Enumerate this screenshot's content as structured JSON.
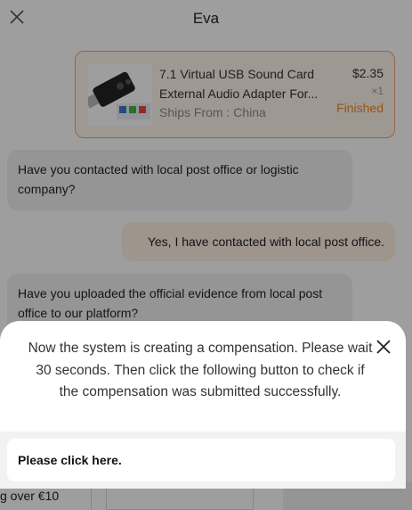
{
  "header": {
    "title": "Eva",
    "close_icon": "close-icon"
  },
  "order": {
    "name_line1": "7.1 Virtual USB Sound Card",
    "name_line2": "External Audio Adapter For...",
    "ships_from": "Ships From : China",
    "price": "$2.35",
    "quantity": "×1",
    "status": "Finished",
    "thumbnail_icon": "usb-sound-card-image"
  },
  "messages": [
    {
      "side": "left",
      "text": "Have you contacted with local post office or logistic company?"
    },
    {
      "side": "right",
      "text": "Yes, I have contacted with local post office."
    },
    {
      "side": "left",
      "text": "Have you uploaded the official evidence from local post office to our platform?"
    }
  ],
  "footer": {
    "snippet": "g over €10"
  },
  "popup": {
    "message": "Now the system is creating a compensation. Please wait 30 seconds. Then click the following button to check if the compensation was submitted successfully.",
    "action_label": "Please click here.",
    "close_icon": "close-icon"
  },
  "colors": {
    "accent": "#f08a24",
    "card_border": "#f0a36c",
    "overlay": "rgba(0,0,0,0.38)"
  }
}
